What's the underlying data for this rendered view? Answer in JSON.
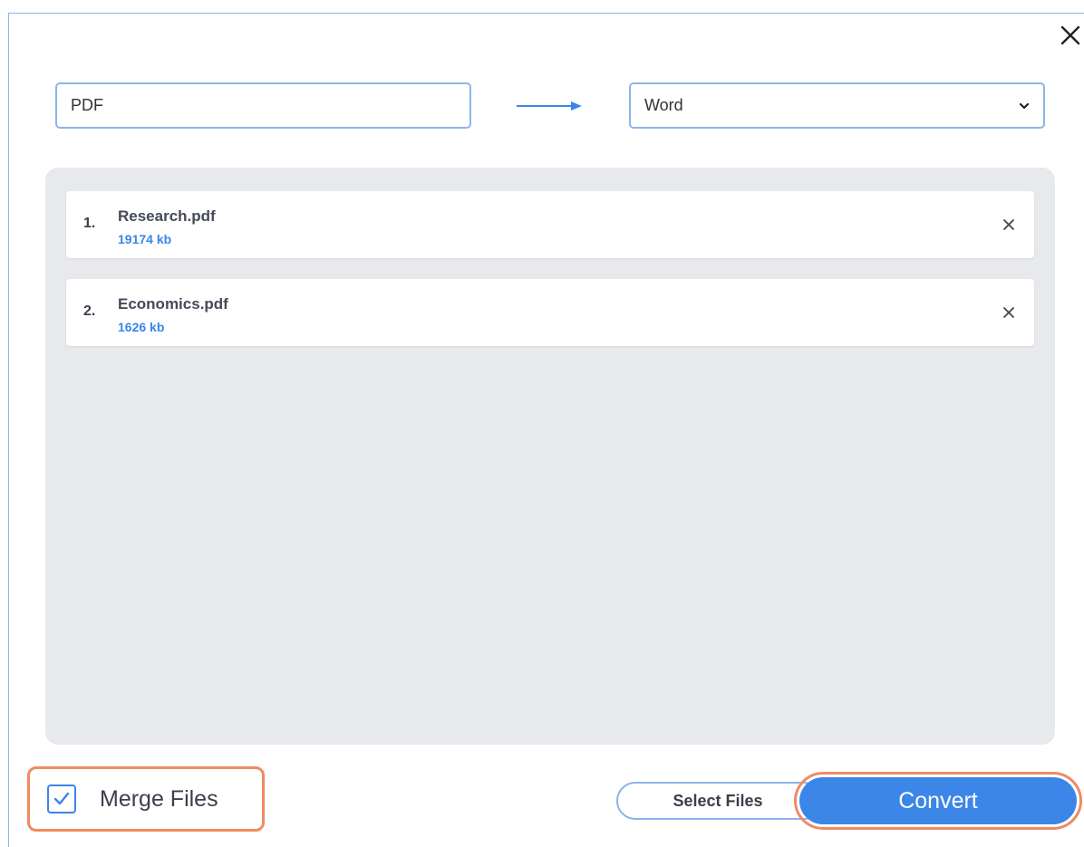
{
  "dialog": {
    "close_icon": "close-icon"
  },
  "format": {
    "from": "PDF",
    "to": "Word",
    "arrow_icon": "arrow-right-icon",
    "dropdown_icon": "chevron-down-icon"
  },
  "files": [
    {
      "index": "1.",
      "name": "Research.pdf",
      "size": "19174 kb"
    },
    {
      "index": "2.",
      "name": "Economics.pdf",
      "size": "1626 kb"
    }
  ],
  "footer": {
    "merge_label": "Merge Files",
    "merge_checked": true,
    "select_files_label": "Select Files",
    "convert_label": "Convert"
  },
  "colors": {
    "accent": "#3c86e7",
    "highlight": "#f08a62",
    "file_area_bg": "#e8e9ec",
    "size_text": "#3a86e8"
  }
}
